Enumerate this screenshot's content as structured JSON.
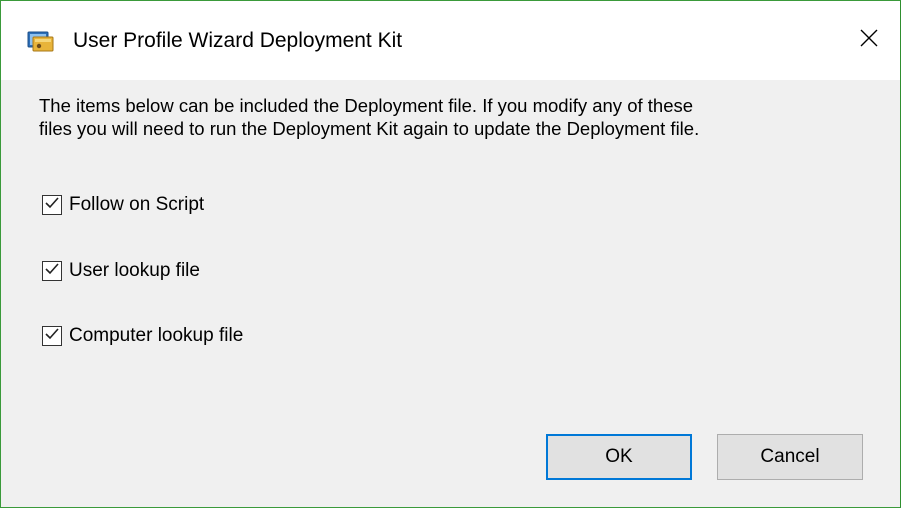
{
  "window": {
    "title": "User Profile Wizard Deployment Kit",
    "close_icon": "close-icon",
    "app_icon": "deployment-kit-icon",
    "border_color": "#3a9a3a"
  },
  "content": {
    "description_line1": "The items below can be included the Deployment file. If you modify any of these",
    "description_line2": "files you will need to run the Deployment Kit again to update the Deployment file.",
    "checkboxes": [
      {
        "label": "Follow on Script",
        "checked": true
      },
      {
        "label": "User lookup file",
        "checked": true
      },
      {
        "label": "Computer lookup file",
        "checked": true
      }
    ]
  },
  "buttons": {
    "ok_label": "OK",
    "cancel_label": "Cancel",
    "default_accent": "#0078d7"
  }
}
